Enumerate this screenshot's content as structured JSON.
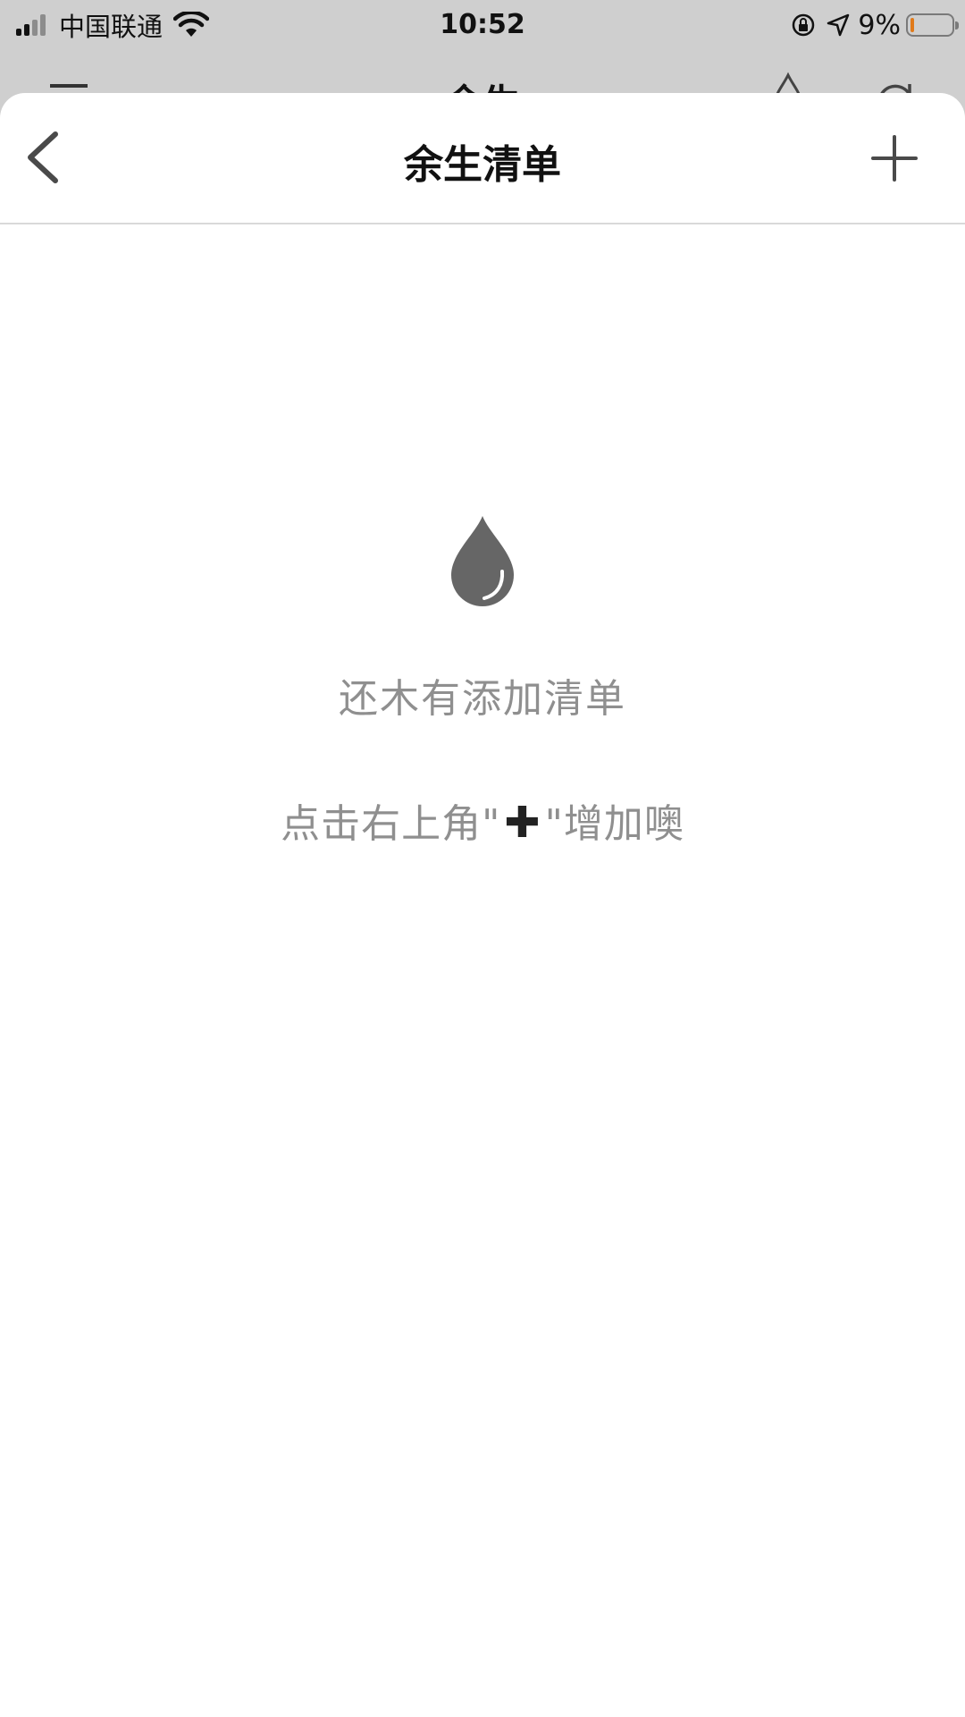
{
  "status_bar": {
    "carrier": "中国联通",
    "time": "10:52",
    "battery": "9%",
    "battery_level": 0.09
  },
  "underlying": {
    "title": "余生"
  },
  "nav": {
    "title": "余生清单"
  },
  "empty_state": {
    "title": "还木有添加清单",
    "hint_before": "点击右上角\"",
    "hint_plus": "✚",
    "hint_after": "\"增加噢"
  },
  "colors": {
    "icon_gray": "#666666",
    "text_gray": "#8f8f8f",
    "battery_low": "#e07a1a"
  }
}
